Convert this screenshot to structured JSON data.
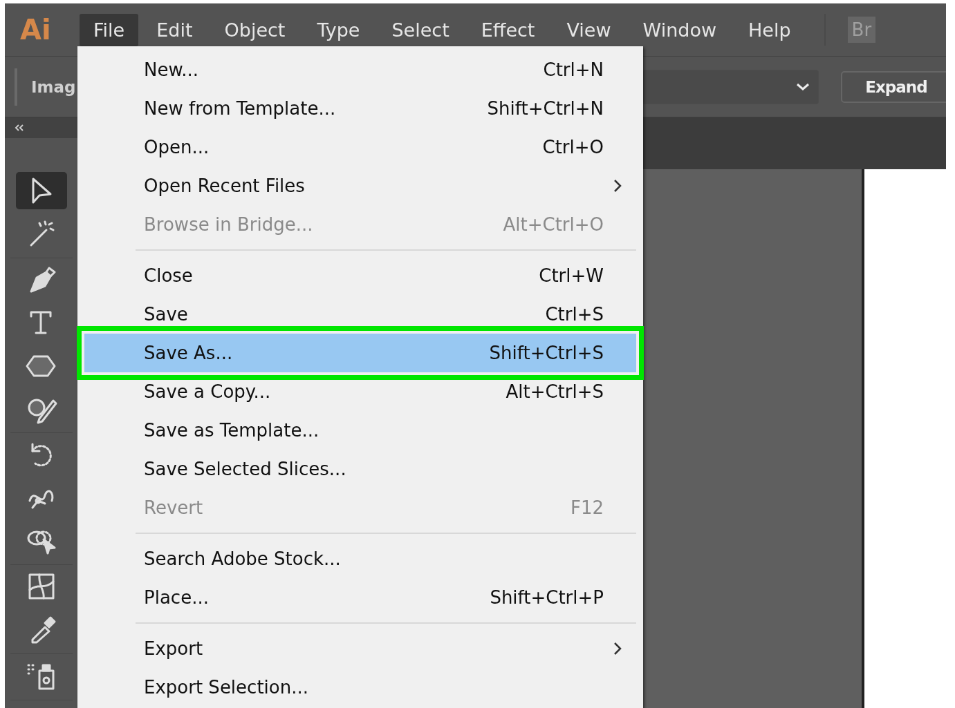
{
  "menu_bar": {
    "logo": "Ai",
    "items": [
      {
        "label": "File",
        "selected": true
      },
      {
        "label": "Edit",
        "selected": false
      },
      {
        "label": "Object",
        "selected": false
      },
      {
        "label": "Type",
        "selected": false
      },
      {
        "label": "Select",
        "selected": false
      },
      {
        "label": "Effect",
        "selected": false
      },
      {
        "label": "View",
        "selected": false
      },
      {
        "label": "Window",
        "selected": false
      },
      {
        "label": "Help",
        "selected": false
      }
    ],
    "bridge_button": "Br"
  },
  "control_bar": {
    "label": "Imag",
    "expand_button": "Expand"
  },
  "tool_groups": [
    [
      {
        "kind": "selection",
        "selected": true
      },
      {
        "kind": "magic-wand",
        "selected": false
      }
    ],
    [
      {
        "kind": "pen",
        "selected": false
      },
      {
        "kind": "type",
        "selected": false
      },
      {
        "kind": "hexagon",
        "selected": false
      },
      {
        "kind": "shaper",
        "selected": false
      }
    ],
    [
      {
        "kind": "rotate",
        "selected": false
      },
      {
        "kind": "warp",
        "selected": false
      },
      {
        "kind": "shape-builder",
        "selected": false
      }
    ],
    [
      {
        "kind": "mesh",
        "selected": false
      },
      {
        "kind": "eyedropper",
        "selected": false
      }
    ],
    [
      {
        "kind": "symbol-sprayer",
        "selected": false
      }
    ]
  ],
  "file_menu": [
    {
      "kind": "item",
      "label": "New...",
      "shortcut": "Ctrl+N",
      "disabled": false,
      "submenu": false,
      "selected": false
    },
    {
      "kind": "item",
      "label": "New from Template...",
      "shortcut": "Shift+Ctrl+N",
      "disabled": false,
      "submenu": false,
      "selected": false
    },
    {
      "kind": "item",
      "label": "Open...",
      "shortcut": "Ctrl+O",
      "disabled": false,
      "submenu": false,
      "selected": false
    },
    {
      "kind": "item",
      "label": "Open Recent Files",
      "disabled": false,
      "submenu": true,
      "selected": false
    },
    {
      "kind": "item",
      "label": "Browse in Bridge...",
      "shortcut": "Alt+Ctrl+O",
      "disabled": true,
      "submenu": false,
      "selected": false
    },
    {
      "kind": "separator"
    },
    {
      "kind": "item",
      "label": "Close",
      "shortcut": "Ctrl+W",
      "disabled": false,
      "submenu": false,
      "selected": false
    },
    {
      "kind": "item",
      "label": "Save",
      "shortcut": "Ctrl+S",
      "disabled": false,
      "submenu": false,
      "selected": false
    },
    {
      "kind": "item",
      "label": "Save As...",
      "shortcut": "Shift+Ctrl+S",
      "disabled": false,
      "submenu": false,
      "selected": true
    },
    {
      "kind": "item",
      "label": "Save a Copy...",
      "shortcut": "Alt+Ctrl+S",
      "disabled": false,
      "submenu": false,
      "selected": false
    },
    {
      "kind": "item",
      "label": "Save as Template...",
      "disabled": false,
      "submenu": false,
      "selected": false
    },
    {
      "kind": "item",
      "label": "Save Selected Slices...",
      "disabled": false,
      "submenu": false,
      "selected": false
    },
    {
      "kind": "item",
      "label": "Revert",
      "shortcut": "F12",
      "disabled": true,
      "submenu": false,
      "selected": false
    },
    {
      "kind": "separator"
    },
    {
      "kind": "item",
      "label": "Search Adobe Stock...",
      "disabled": false,
      "submenu": false,
      "selected": false
    },
    {
      "kind": "item",
      "label": "Place...",
      "shortcut": "Shift+Ctrl+P",
      "disabled": false,
      "submenu": false,
      "selected": false
    },
    {
      "kind": "separator"
    },
    {
      "kind": "item",
      "label": "Export",
      "disabled": false,
      "submenu": true,
      "selected": false
    },
    {
      "kind": "item",
      "label": "Export Selection...",
      "disabled": false,
      "submenu": false,
      "selected": false
    }
  ]
}
